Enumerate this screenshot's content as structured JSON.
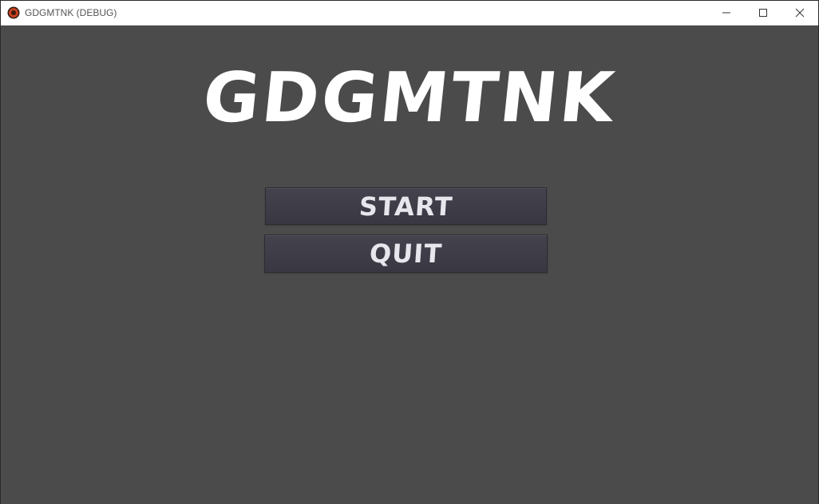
{
  "window": {
    "title": "GDGMTNK (DEBUG)",
    "controls": {
      "minimize_icon": "minimize-icon",
      "maximize_icon": "maximize-icon",
      "close_icon": "close-icon"
    }
  },
  "game": {
    "title": "GDGMTNK",
    "menu": {
      "start_label": "START",
      "quit_label": "QUIT"
    }
  },
  "colors": {
    "background": "#4b4b4b",
    "button": "#3f3e48",
    "text": "#ffffff"
  }
}
